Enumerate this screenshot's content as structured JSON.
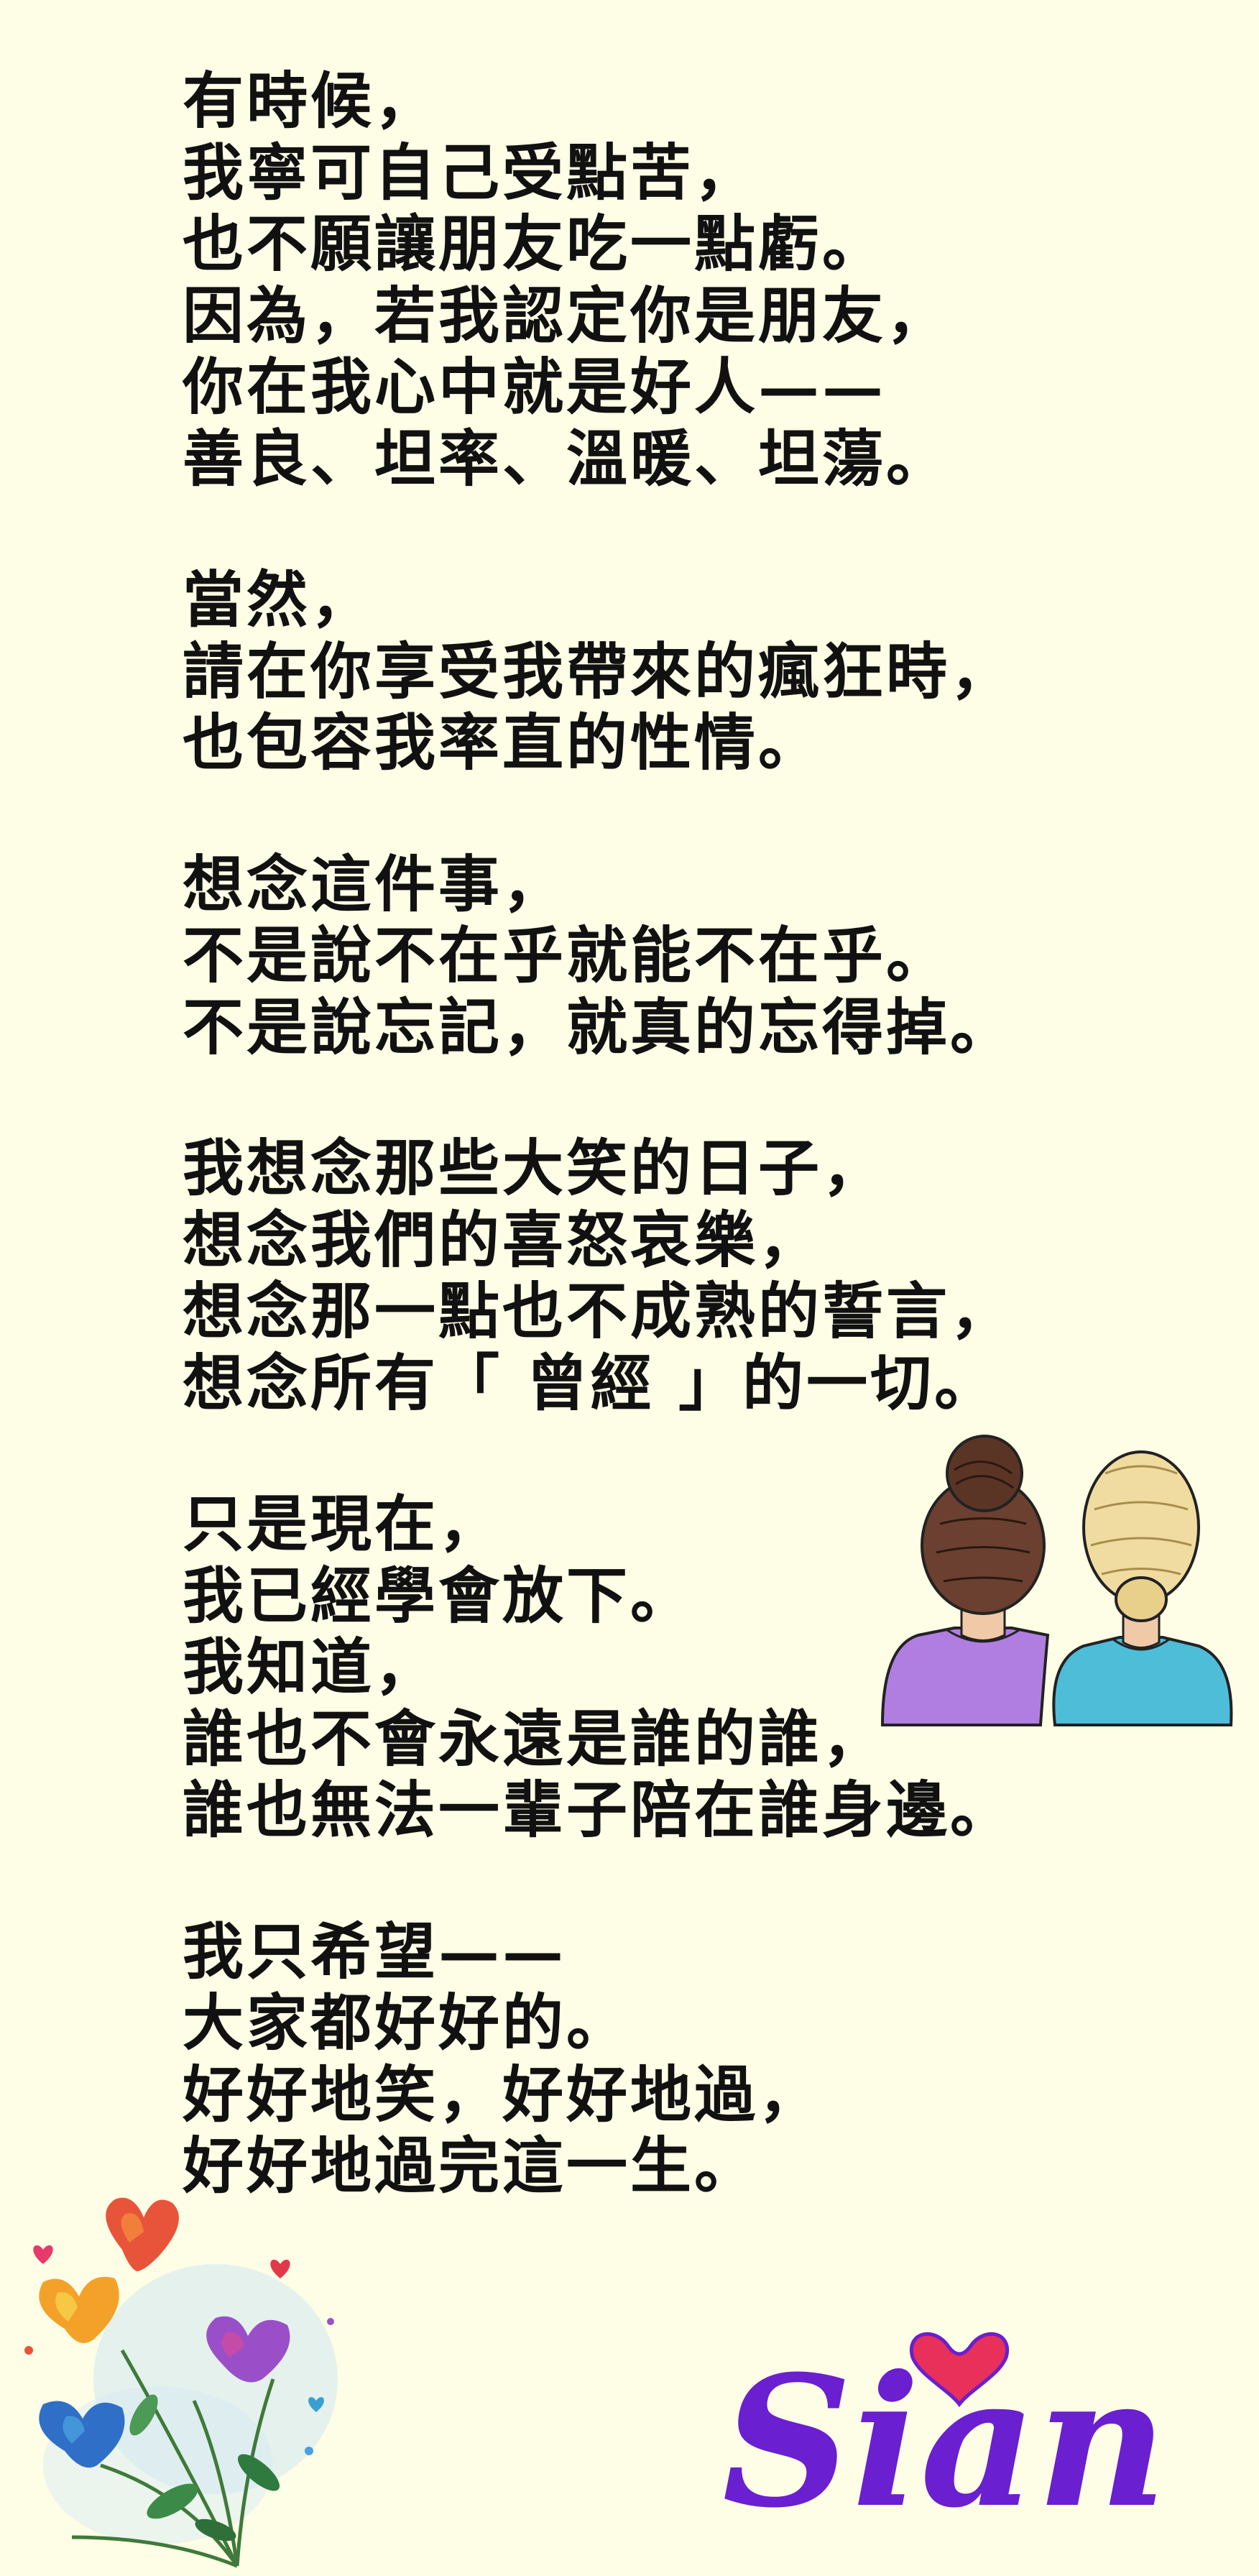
{
  "poem": {
    "stanzas": [
      [
        "有時候，",
        "我寧可自己受點苦，",
        "也不願讓朋友吃一點虧。",
        "因為，若我認定你是朋友，",
        "你在我心中就是好人——",
        "善良、坦率、溫暖、坦蕩。"
      ],
      [
        "當然，",
        "請在你享受我帶來的瘋狂時，",
        "也包容我率直的性情。"
      ],
      [
        "想念這件事，",
        "不是說不在乎就能不在乎。",
        "不是說忘記，就真的忘得掉。"
      ],
      [
        "我想念那些大笑的日子，",
        "想念我們的喜怒哀樂，",
        "想念那一點也不成熟的誓言，",
        "想念所有「 曾經 」的一切。"
      ],
      [
        "只是現在，",
        "我已經學會放下。",
        "我知道，",
        "誰也不會永遠是誰的誰，",
        "誰也無法一輩子陪在誰身邊。"
      ],
      [
        "我只希望——",
        "大家都好好的。",
        "好好地笑，好好地過，",
        "好好地過完這一生。"
      ]
    ]
  },
  "signature": {
    "text": "Sian",
    "color": "#6a1fd0",
    "heart_color": "#e8305a"
  },
  "illustrations": {
    "girls": "two-girls-back-view-illustration",
    "flowers": "watercolor-flowers-illustration"
  },
  "colors": {
    "background": "#fefde6",
    "text": "#111111"
  }
}
